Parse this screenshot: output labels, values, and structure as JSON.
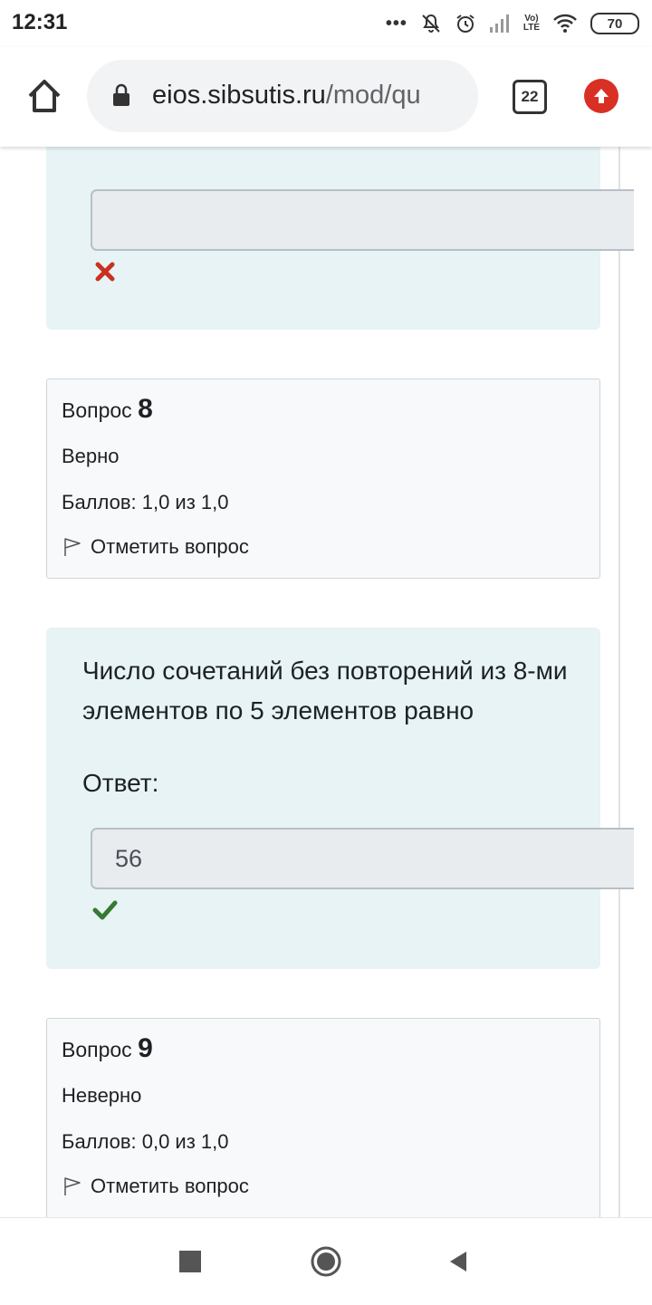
{
  "status": {
    "time": "12:31",
    "battery": "70",
    "volte_line1": "Vo)",
    "volte_line2": "LTE"
  },
  "browser": {
    "url_domain": "eios.sibsutis.ru",
    "url_path": "/mod/qu",
    "tabs_count": "22"
  },
  "quiz": {
    "prev_question": {
      "answer_value": "",
      "result_icon": "cross-icon"
    },
    "q8": {
      "label": "Вопрос",
      "number": "8",
      "status": "Верно",
      "score": "Баллов: 1,0 из 1,0",
      "flag_label": "Отметить вопрос",
      "text": "Число сочетаний без повторений из 8-ми элементов по 5 элементов равно",
      "answer_label": "Ответ:",
      "answer_value": "56",
      "result_icon": "check-icon"
    },
    "q9": {
      "label": "Вопрос",
      "number": "9",
      "status": "Неверно",
      "score": "Баллов: 0,0 из 1,0",
      "flag_label": "Отметить вопрос"
    }
  },
  "colors": {
    "formulation_bg": "#e7f3f5",
    "correct": "#357a32",
    "incorrect": "#ca3120",
    "update_button": "#d93025"
  }
}
